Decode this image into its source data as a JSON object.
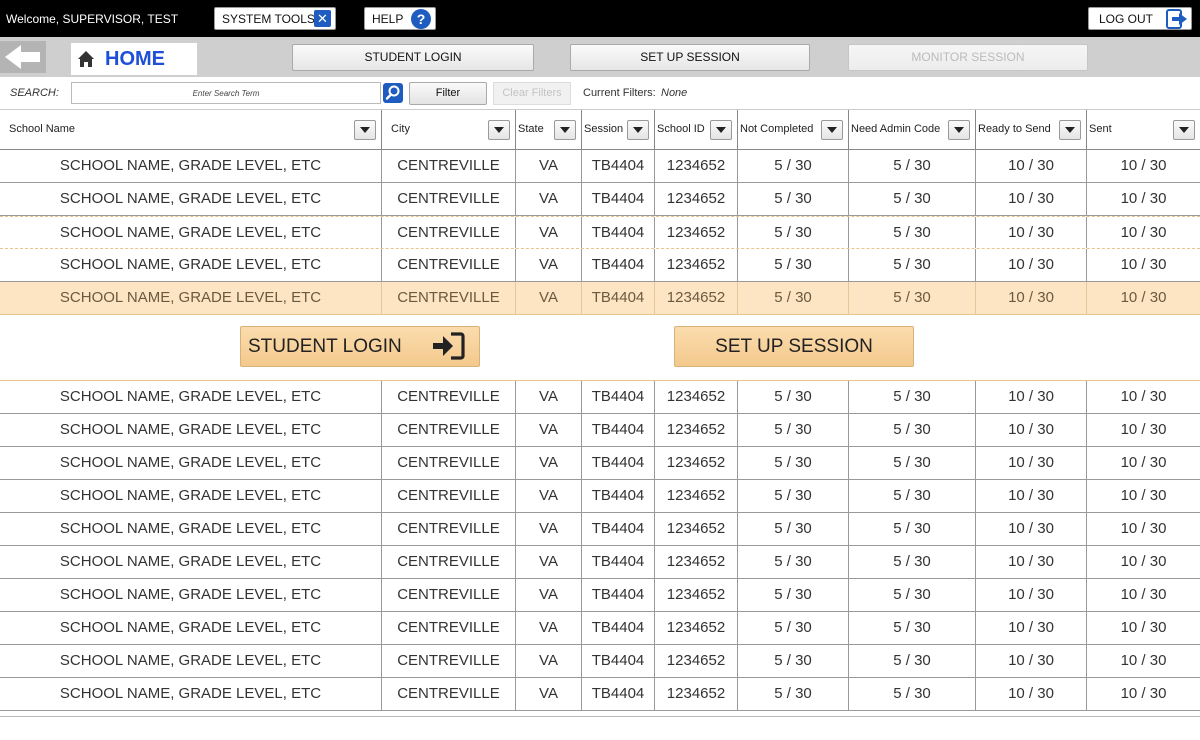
{
  "header": {
    "welcome": "Welcome, SUPERVISOR, TEST",
    "system_tools_label": "SYSTEM TOOLS",
    "help_label": "HELP",
    "logout_label": "LOG OUT"
  },
  "nav": {
    "home_label": "HOME",
    "student_login_label": "STUDENT LOGIN",
    "setup_session_label": "SET UP SESSION",
    "monitor_session_label": "MONITOR SESSION"
  },
  "search": {
    "label": "SEARCH:",
    "placeholder": "Enter Search Term",
    "filter_label": "Filter",
    "clear_filters_label": "Clear Filters",
    "current_filters_label": "Current Filters:",
    "current_filters_value": "None"
  },
  "table": {
    "columns": [
      "School Name",
      "City",
      "State",
      "Session",
      "School ID",
      "Not Completed",
      "Need Admin Code",
      "Ready to Send",
      "Sent"
    ],
    "rows": [
      [
        "SCHOOL NAME, GRADE LEVEL, ETC",
        "CENTREVILLE",
        "VA",
        "TB4404",
        "1234652",
        "5 / 30",
        "5 / 30",
        "10 / 30",
        "10 / 30"
      ],
      [
        "SCHOOL NAME, GRADE LEVEL, ETC",
        "CENTREVILLE",
        "VA",
        "TB4404",
        "1234652",
        "5 / 30",
        "5 / 30",
        "10 / 30",
        "10 / 30"
      ],
      [
        "SCHOOL NAME, GRADE LEVEL, ETC",
        "CENTREVILLE",
        "VA",
        "TB4404",
        "1234652",
        "5 / 30",
        "5 / 30",
        "10 / 30",
        "10 / 30"
      ],
      [
        "SCHOOL NAME, GRADE LEVEL, ETC",
        "CENTREVILLE",
        "VA",
        "TB4404",
        "1234652",
        "5 / 30",
        "5 / 30",
        "10 / 30",
        "10 / 30"
      ],
      [
        "SCHOOL NAME, GRADE LEVEL, ETC",
        "CENTREVILLE",
        "VA",
        "TB4404",
        "1234652",
        "5 / 30",
        "5 / 30",
        "10 / 30",
        "10 / 30"
      ],
      [
        "SCHOOL NAME, GRADE LEVEL, ETC",
        "CENTREVILLE",
        "VA",
        "TB4404",
        "1234652",
        "5 / 30",
        "5 / 30",
        "10 / 30",
        "10 / 30"
      ],
      [
        "SCHOOL NAME, GRADE LEVEL, ETC",
        "CENTREVILLE",
        "VA",
        "TB4404",
        "1234652",
        "5 / 30",
        "5 / 30",
        "10 / 30",
        "10 / 30"
      ],
      [
        "SCHOOL NAME, GRADE LEVEL, ETC",
        "CENTREVILLE",
        "VA",
        "TB4404",
        "1234652",
        "5 / 30",
        "5 / 30",
        "10 / 30",
        "10 / 30"
      ],
      [
        "SCHOOL NAME, GRADE LEVEL, ETC",
        "CENTREVILLE",
        "VA",
        "TB4404",
        "1234652",
        "5 / 30",
        "5 / 30",
        "10 / 30",
        "10 / 30"
      ],
      [
        "SCHOOL NAME, GRADE LEVEL, ETC",
        "CENTREVILLE",
        "VA",
        "TB4404",
        "1234652",
        "5 / 30",
        "5 / 30",
        "10 / 30",
        "10 / 30"
      ],
      [
        "SCHOOL NAME, GRADE LEVEL, ETC",
        "CENTREVILLE",
        "VA",
        "TB4404",
        "1234652",
        "5 / 30",
        "5 / 30",
        "10 / 30",
        "10 / 30"
      ],
      [
        "SCHOOL NAME, GRADE LEVEL, ETC",
        "CENTREVILLE",
        "VA",
        "TB4404",
        "1234652",
        "5 / 30",
        "5 / 30",
        "10 / 30",
        "10 / 30"
      ],
      [
        "SCHOOL NAME, GRADE LEVEL, ETC",
        "CENTREVILLE",
        "VA",
        "TB4404",
        "1234652",
        "5 / 30",
        "5 / 30",
        "10 / 30",
        "10 / 30"
      ],
      [
        "SCHOOL NAME, GRADE LEVEL, ETC",
        "CENTREVILLE",
        "VA",
        "TB4404",
        "1234652",
        "5 / 30",
        "5 / 30",
        "10 / 30",
        "10 / 30"
      ],
      [
        "SCHOOL NAME, GRADE LEVEL, ETC",
        "CENTREVILLE",
        "VA",
        "TB4404",
        "1234652",
        "5 / 30",
        "5 / 30",
        "10 / 30",
        "10 / 30"
      ]
    ],
    "selected_row_index": 4,
    "action_student_login_label": "STUDENT LOGIN",
    "action_setup_session_label": "SET UP SESSION"
  },
  "colors": {
    "brand_blue": "#1e4fd8",
    "selected_row": "#fde4c2",
    "action_button": "#f7d19c"
  }
}
